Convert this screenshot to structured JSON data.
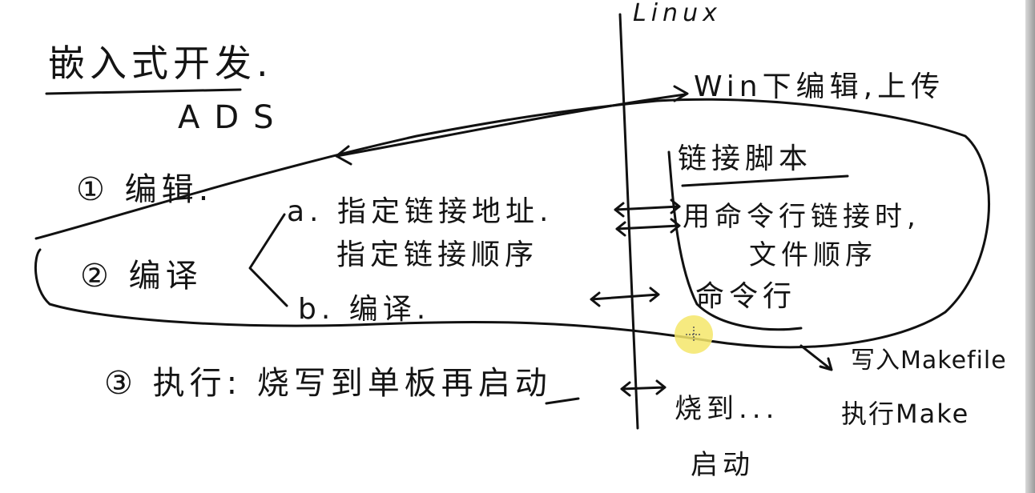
{
  "board": {
    "title": "嵌入式开发.",
    "ads": "ADS",
    "linux": "Linux",
    "win_upload": "Win下编辑,上传",
    "step1": "① 编辑.",
    "step2": "② 编译",
    "step2_a_1": "a. 指定链接地址.",
    "step2_a_2": "指定链接顺序",
    "step2_b": "b. 编译.",
    "step3": "③ 执行: 烧写到单板再启动",
    "link_script": "链接脚本",
    "cmd_link_1": "用命令行链接时,",
    "cmd_link_2": "文件顺序",
    "cmdline": "命令行",
    "makefile": "写入Makefile",
    "exec_make": "执行Make",
    "burn": "烧到...",
    "boot": "启动"
  },
  "colors": {
    "ink": "#111111",
    "cursor": "#f5e66a"
  }
}
